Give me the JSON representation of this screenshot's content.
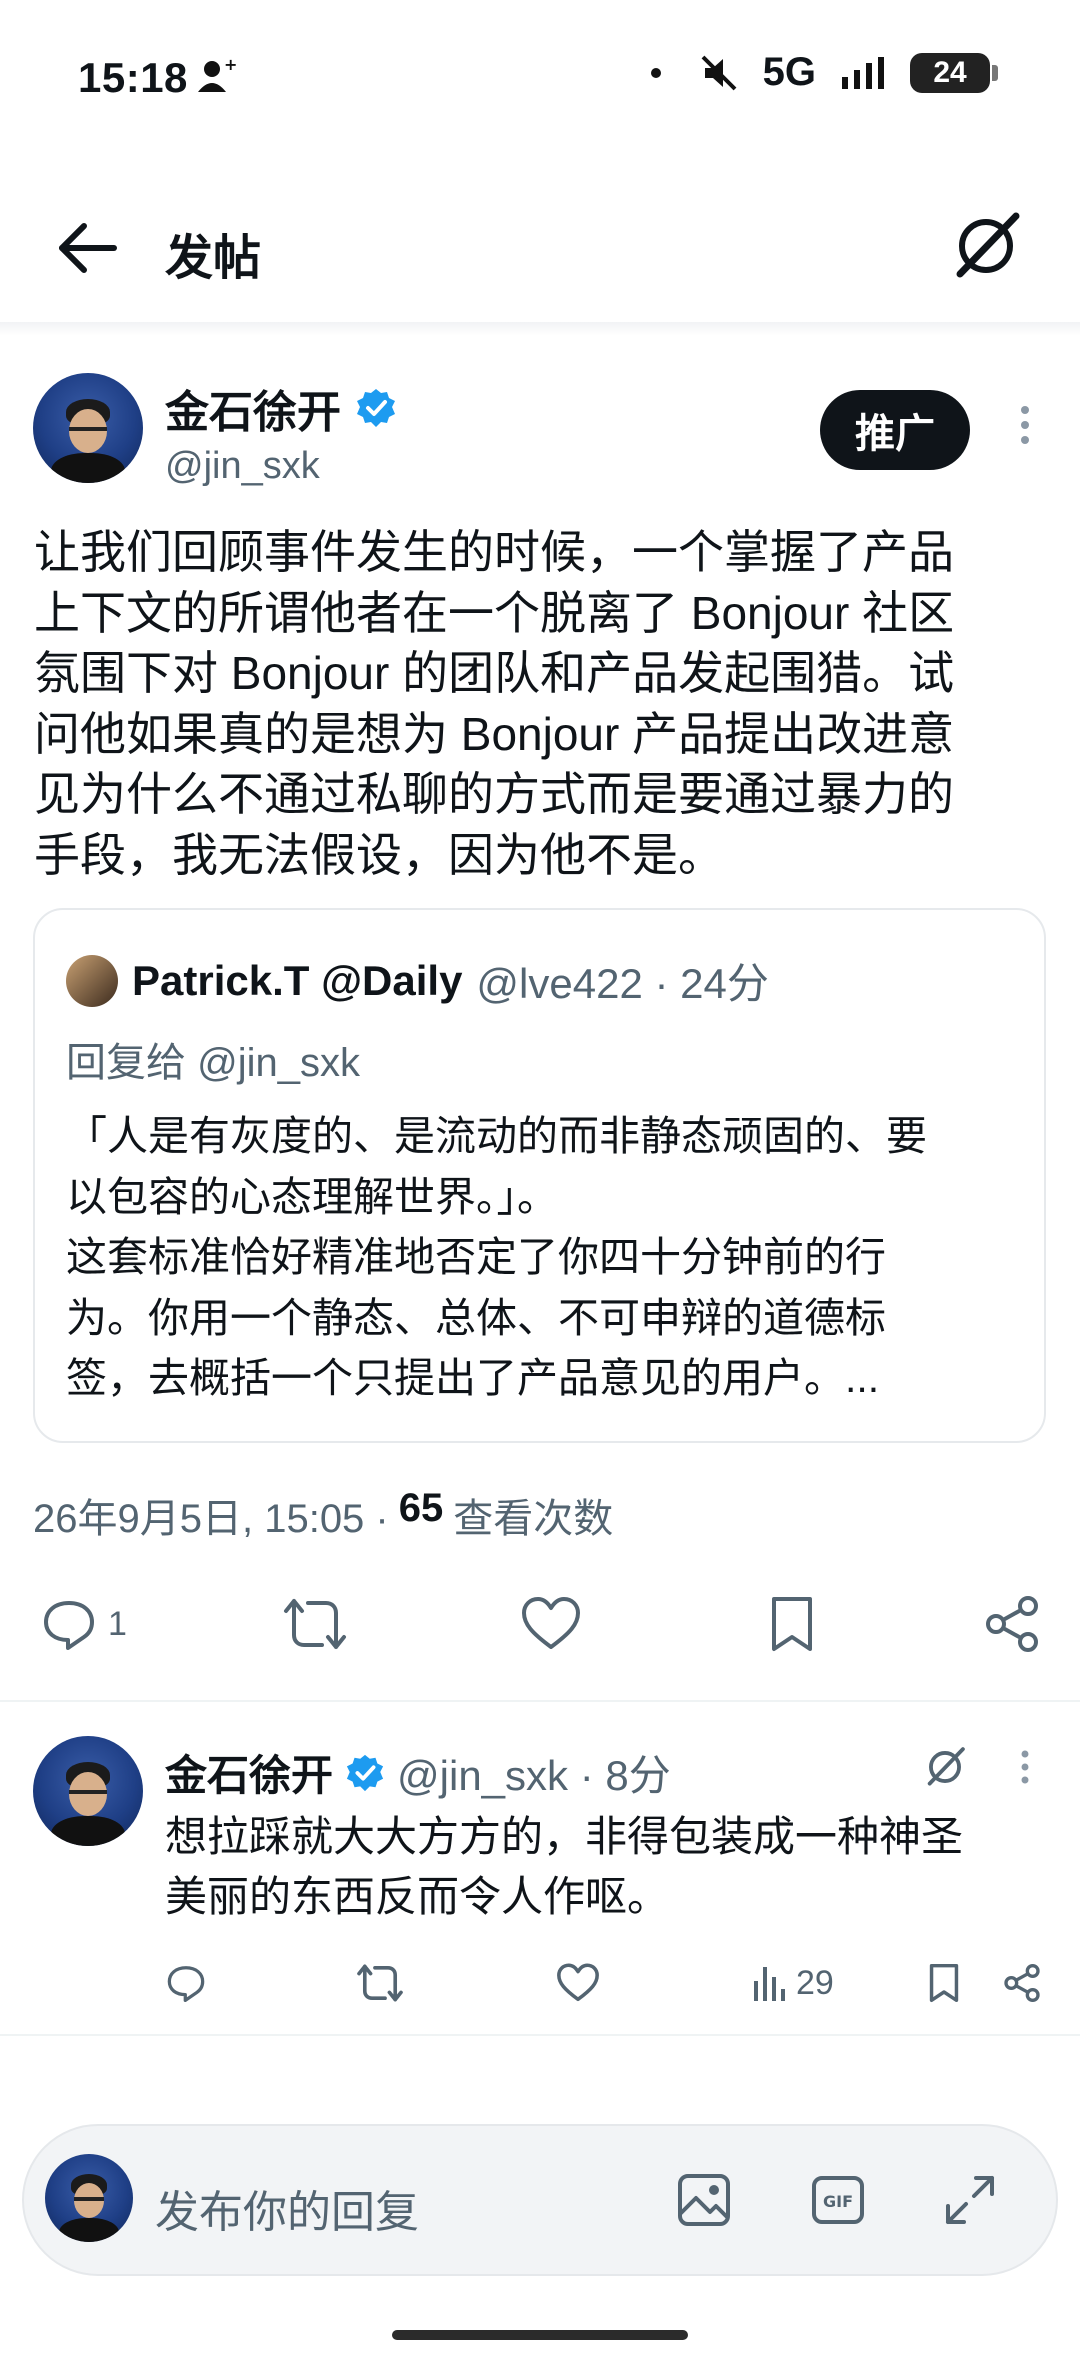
{
  "status_bar": {
    "time": "15:18",
    "network": "5G",
    "battery": "24"
  },
  "header": {
    "title": "发帖"
  },
  "tweet": {
    "author_name": "金石徐开",
    "author_handle": "@jin_sxk",
    "promote_label": "推广",
    "text": "让我们回顾事件发生的时候，一个掌握了产品\n上下文的所谓他者在一个脱离了 Bonjour 社区\n氛围下对 Bonjour 的团队和产品发起围猎。试\n问他如果真的是想为 Bonjour 产品提出改进意\n见为什么不通过私聊的方式而是要通过暴力的\n手段，我无法假设，因为他不是。",
    "quote": {
      "name": "Patrick.T @Daily",
      "meta": "@lve422 · 24分",
      "reply_to": "回复给 @jin_sxk",
      "text": "「人是有灰度的、是流动的而非静态顽固的、要\n以包容的心态理解世界。」。\n这套标准恰好精准地否定了你四十分钟前的行\n为。你用一个静态、总体、不可申辩的道德标\n签，去概括一个只提出了产品意见的用户。..."
    },
    "timestamp": "26年9月5日, 15:05 ·",
    "views_count": "65",
    "views_label": "查看次数",
    "reply_count": "1"
  },
  "reply": {
    "author_name": "金石徐开",
    "meta": "@jin_sxk · 8分",
    "text": "想拉踩就大大方方的，非得包装成一种神圣\n美丽的东西反而令人作呕。",
    "analytics_count": "29"
  },
  "composer": {
    "placeholder": "发布你的回复"
  },
  "colors": {
    "verified": "#1d9bf0",
    "text_primary": "#0f1419",
    "text_secondary": "#536471",
    "button_dark": "#0f1419"
  }
}
